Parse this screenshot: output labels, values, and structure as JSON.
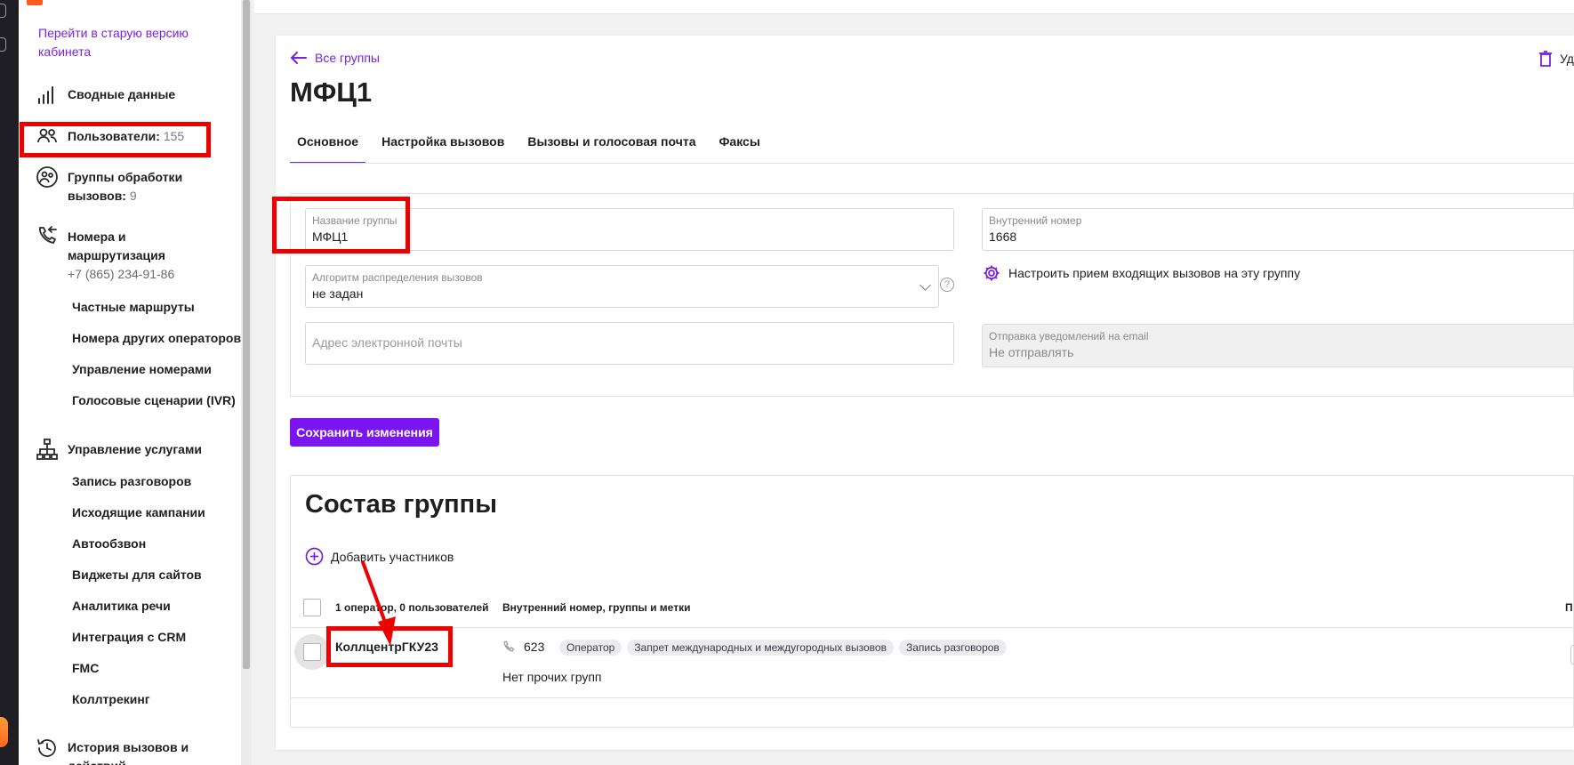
{
  "sidebar": {
    "old_version_link": "Перейти в старую версию кабинета",
    "summary": "Сводные данные",
    "users_label": "Пользователи:",
    "users_count": "155",
    "groups_label_line1": "Группы обработки",
    "groups_label_line2": "вызовов:",
    "groups_count": "9",
    "numbers_line1": "Номера и",
    "numbers_line2": "маршрутизация",
    "phone": "+7 (865) 234-91-86",
    "numbers_sub": [
      "Частные маршруты",
      "Номера других операторов",
      "Управление номерами",
      "Голосовые сценарии (IVR)"
    ],
    "services": "Управление услугами",
    "services_sub": [
      "Запись разговоров",
      "Исходящие кампании",
      "Автообзвон",
      "Виджеты для сайтов",
      "Аналитика речи",
      "Интеграция с CRM",
      "FMC",
      "Коллтрекинг"
    ],
    "history_line1": "История вызовов и",
    "history_line2": "действий"
  },
  "header": {
    "back_link": "Все группы",
    "delete_link": "Уд",
    "title": "МФЦ1"
  },
  "tabs": [
    {
      "label": "Основное",
      "active": true
    },
    {
      "label": "Настройка вызовов",
      "active": false
    },
    {
      "label": "Вызовы и голосовая почта",
      "active": false
    },
    {
      "label": "Факсы",
      "active": false
    }
  ],
  "form": {
    "group_name_label": "Название группы",
    "group_name_value": "МФЦ1",
    "internal_number_label": "Внутренний номер",
    "internal_number_value": "1668",
    "algorithm_label": "Алгоритм распределения вызовов",
    "algorithm_value": "не задан",
    "help_glyph": "?",
    "configure_link": "Настроить прием входящих вызовов на эту группу",
    "email_placeholder": "Адрес электронной почты",
    "email_notify_label": "Отправка уведомлений на email",
    "email_notify_value": "Не отправлять",
    "save_button": "Сохранить изменения"
  },
  "members": {
    "title": "Состав группы",
    "add_link": "Добавить участников",
    "col_users": "1 оператор, 0 пользователей",
    "col_ext": "Внутренний номер, группы и метки",
    "col_right": "П",
    "rows": [
      {
        "name": "КоллцентрГКУ23",
        "ext": "623",
        "tags": [
          "Оператор",
          "Запрет международных и междугородных вызовов",
          "Запись разговоров"
        ],
        "other_groups": "Нет прочих групп"
      }
    ]
  },
  "colors": {
    "accent": "#7a15f0",
    "link": "#7a22e0",
    "highlight": "#ee0000",
    "logo": "#ff5a1f"
  }
}
